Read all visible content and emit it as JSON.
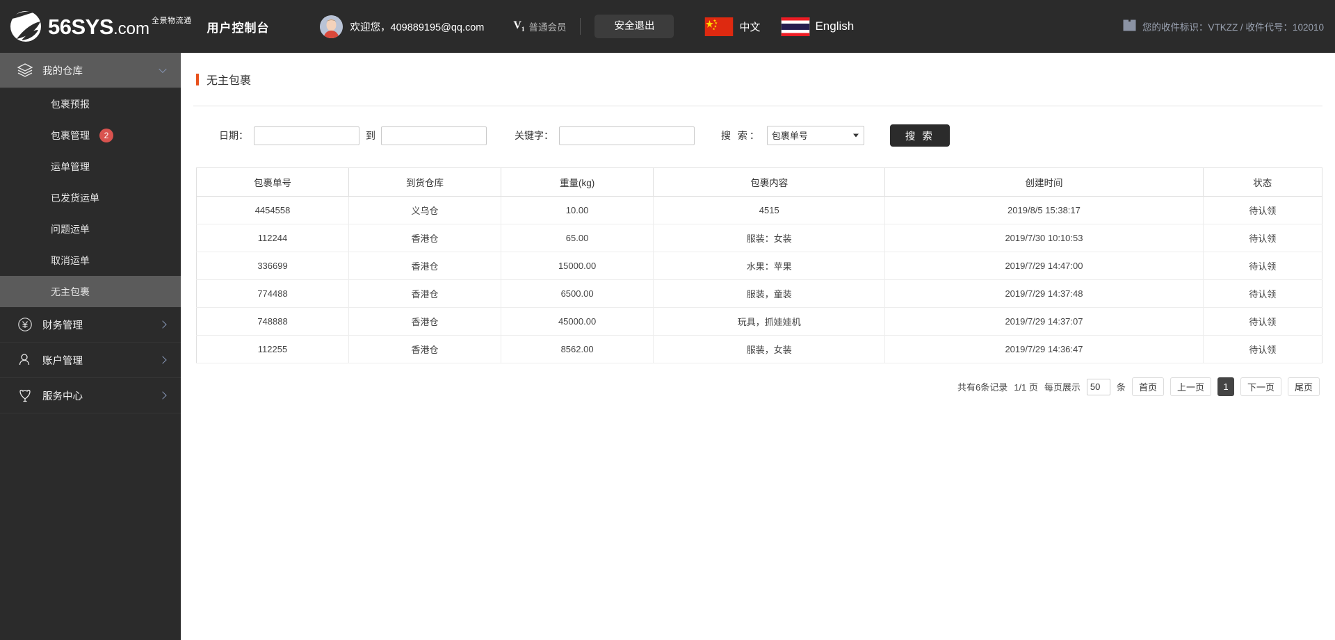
{
  "header": {
    "logo_text": "56SYS",
    "logo_dotcom": ".com",
    "logo_cn": "全景物流通",
    "console_title": "用户控制台",
    "welcome": "欢迎您，409889195@qq.com",
    "vip_icon": "V",
    "vip_sub": "1",
    "vip_label": "普通会员",
    "logout_label": "安全退出",
    "lang_cn": "中文",
    "lang_en": "English",
    "recv_info": "您的收件标识：VTKZZ / 收件代号：102010"
  },
  "sidebar": {
    "groups": [
      {
        "label": "我的仓库",
        "icon": "layers-icon",
        "expanded": true,
        "items": [
          {
            "label": "包裹预报",
            "badge": ""
          },
          {
            "label": "包裹管理",
            "badge": "2"
          },
          {
            "label": "运单管理",
            "badge": ""
          },
          {
            "label": "已发货运单",
            "badge": ""
          },
          {
            "label": "问题运单",
            "badge": ""
          },
          {
            "label": "取消运单",
            "badge": ""
          },
          {
            "label": "无主包裹",
            "badge": ""
          }
        ]
      },
      {
        "label": "财务管理",
        "icon": "yen-icon",
        "expanded": false,
        "items": []
      },
      {
        "label": "账户管理",
        "icon": "user-icon",
        "expanded": false,
        "items": []
      },
      {
        "label": "服务中心",
        "icon": "shield-icon",
        "expanded": false,
        "items": []
      }
    ],
    "active_item": "无主包裹"
  },
  "main": {
    "page_title": "无主包裹",
    "search": {
      "date_label": "日期：",
      "date_from_value": "",
      "date_from_placeholder": "",
      "to_label": "到",
      "date_to_value": "",
      "date_to_placeholder": "",
      "keyword_label": "关键字：",
      "keyword_value": "",
      "keyword_placeholder": "",
      "search_by_label": "搜 索：",
      "search_by_selected": "包裹单号",
      "search_by_options": [
        "包裹单号"
      ],
      "search_button": "搜 索"
    },
    "table": {
      "columns": [
        "包裹单号",
        "到货仓库",
        "重量(kg)",
        "包裹内容",
        "创建时间",
        "状态"
      ],
      "rows": [
        [
          "4454558",
          "义乌仓",
          "10.00",
          "4515",
          "2019/8/5 15:38:17",
          "待认领"
        ],
        [
          "112244",
          "香港仓",
          "65.00",
          "服装：女装",
          "2019/7/30 10:10:53",
          "待认领"
        ],
        [
          "336699",
          "香港仓",
          "15000.00",
          "水果：苹果",
          "2019/7/29 14:47:00",
          "待认领"
        ],
        [
          "774488",
          "香港仓",
          "6500.00",
          "服装，童装",
          "2019/7/29 14:37:48",
          "待认领"
        ],
        [
          "748888",
          "香港仓",
          "45000.00",
          "玩具，抓娃娃机",
          "2019/7/29 14:37:07",
          "待认领"
        ],
        [
          "112255",
          "香港仓",
          "8562.00",
          "服装，女装",
          "2019/7/29 14:36:47",
          "待认领"
        ]
      ]
    },
    "pagination": {
      "total_text": "共有6条记录",
      "page_text": "1/1 页",
      "per_page_label": "每页展示",
      "per_page_value": "50",
      "unit_text": "条",
      "first_label": "首页",
      "prev_label": "上一页",
      "current_page": "1",
      "next_label": "下一页",
      "last_label": "尾页"
    }
  },
  "colors": {
    "header_bg": "#2b2b2b",
    "sidebar_bg": "#2b2b2b",
    "sidebar_active": "#5b5b5b",
    "accent": "#e8511d",
    "badge": "#d9534f"
  }
}
